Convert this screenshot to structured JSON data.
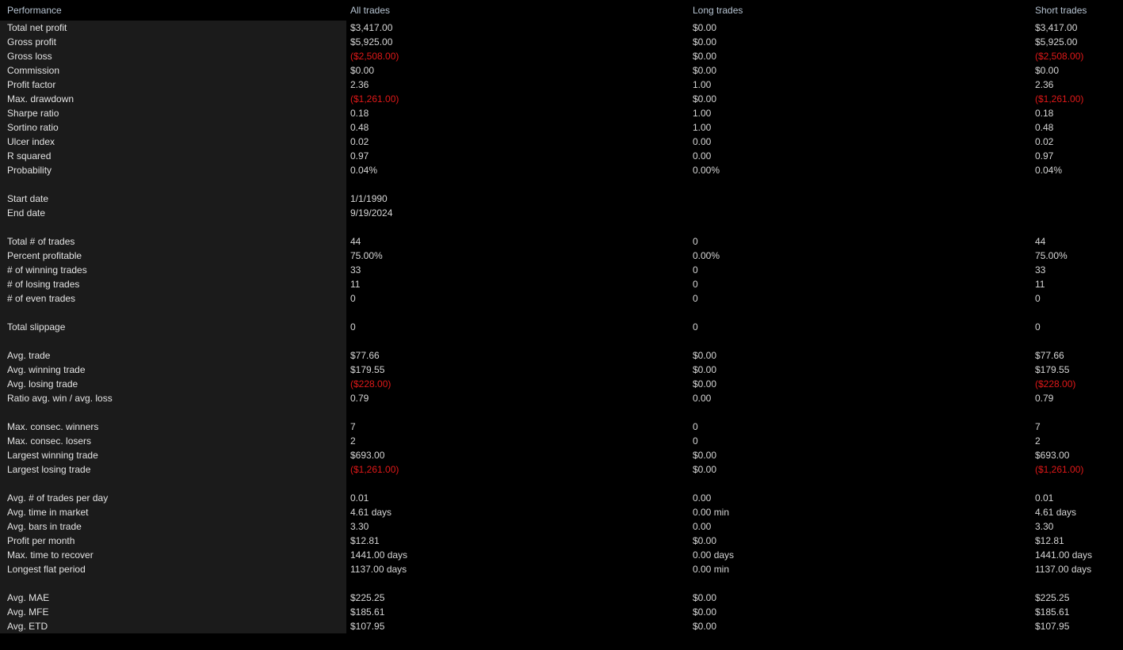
{
  "header": {
    "label_column": "Performance",
    "columns": [
      "All trades",
      "Long trades",
      "Short trades"
    ]
  },
  "colors": {
    "background": "#000000",
    "label_panel": "#1b1b1b",
    "header_text": "#b6c3d1",
    "value_text": "#d6d6d6",
    "negative_text": "#e01818"
  },
  "sections": [
    {
      "rows": [
        {
          "label": "Total net profit",
          "all": "$3,417.00",
          "long": "$0.00",
          "short": "$3,417.00",
          "all_neg": false,
          "long_neg": false,
          "short_neg": false
        },
        {
          "label": "Gross profit",
          "all": "$5,925.00",
          "long": "$0.00",
          "short": "$5,925.00",
          "all_neg": false,
          "long_neg": false,
          "short_neg": false
        },
        {
          "label": "Gross loss",
          "all": "($2,508.00)",
          "long": "$0.00",
          "short": "($2,508.00)",
          "all_neg": true,
          "long_neg": false,
          "short_neg": true
        },
        {
          "label": "Commission",
          "all": "$0.00",
          "long": "$0.00",
          "short": "$0.00",
          "all_neg": false,
          "long_neg": false,
          "short_neg": false
        },
        {
          "label": "Profit factor",
          "all": "2.36",
          "long": "1.00",
          "short": "2.36",
          "all_neg": false,
          "long_neg": false,
          "short_neg": false
        },
        {
          "label": "Max. drawdown",
          "all": "($1,261.00)",
          "long": "$0.00",
          "short": "($1,261.00)",
          "all_neg": true,
          "long_neg": false,
          "short_neg": true
        },
        {
          "label": "Sharpe ratio",
          "all": "0.18",
          "long": "1.00",
          "short": "0.18",
          "all_neg": false,
          "long_neg": false,
          "short_neg": false
        },
        {
          "label": "Sortino ratio",
          "all": "0.48",
          "long": "1.00",
          "short": "0.48",
          "all_neg": false,
          "long_neg": false,
          "short_neg": false
        },
        {
          "label": "Ulcer index",
          "all": "0.02",
          "long": "0.00",
          "short": "0.02",
          "all_neg": false,
          "long_neg": false,
          "short_neg": false
        },
        {
          "label": "R squared",
          "all": "0.97",
          "long": "0.00",
          "short": "0.97",
          "all_neg": false,
          "long_neg": false,
          "short_neg": false
        },
        {
          "label": "Probability",
          "all": "0.04%",
          "long": "0.00%",
          "short": "0.04%",
          "all_neg": false,
          "long_neg": false,
          "short_neg": false
        }
      ]
    },
    {
      "rows": [
        {
          "label": "Start date",
          "all": "1/1/1990",
          "long": "",
          "short": "",
          "all_neg": false,
          "long_neg": false,
          "short_neg": false
        },
        {
          "label": "End date",
          "all": "9/19/2024",
          "long": "",
          "short": "",
          "all_neg": false,
          "long_neg": false,
          "short_neg": false
        }
      ]
    },
    {
      "rows": [
        {
          "label": "Total # of trades",
          "all": "44",
          "long": "0",
          "short": "44",
          "all_neg": false,
          "long_neg": false,
          "short_neg": false
        },
        {
          "label": "Percent profitable",
          "all": "75.00%",
          "long": "0.00%",
          "short": "75.00%",
          "all_neg": false,
          "long_neg": false,
          "short_neg": false
        },
        {
          "label": "# of winning trades",
          "all": "33",
          "long": "0",
          "short": "33",
          "all_neg": false,
          "long_neg": false,
          "short_neg": false
        },
        {
          "label": "# of losing trades",
          "all": "11",
          "long": "0",
          "short": "11",
          "all_neg": false,
          "long_neg": false,
          "short_neg": false
        },
        {
          "label": "# of even trades",
          "all": "0",
          "long": "0",
          "short": "0",
          "all_neg": false,
          "long_neg": false,
          "short_neg": false
        }
      ]
    },
    {
      "rows": [
        {
          "label": "Total slippage",
          "all": "0",
          "long": "0",
          "short": "0",
          "all_neg": false,
          "long_neg": false,
          "short_neg": false
        }
      ]
    },
    {
      "rows": [
        {
          "label": "Avg. trade",
          "all": "$77.66",
          "long": "$0.00",
          "short": "$77.66",
          "all_neg": false,
          "long_neg": false,
          "short_neg": false
        },
        {
          "label": "Avg. winning trade",
          "all": "$179.55",
          "long": "$0.00",
          "short": "$179.55",
          "all_neg": false,
          "long_neg": false,
          "short_neg": false
        },
        {
          "label": "Avg. losing trade",
          "all": "($228.00)",
          "long": "$0.00",
          "short": "($228.00)",
          "all_neg": true,
          "long_neg": false,
          "short_neg": true
        },
        {
          "label": "Ratio avg. win / avg. loss",
          "all": "0.79",
          "long": "0.00",
          "short": "0.79",
          "all_neg": false,
          "long_neg": false,
          "short_neg": false
        }
      ]
    },
    {
      "rows": [
        {
          "label": "Max. consec. winners",
          "all": "7",
          "long": "0",
          "short": "7",
          "all_neg": false,
          "long_neg": false,
          "short_neg": false
        },
        {
          "label": "Max. consec. losers",
          "all": "2",
          "long": "0",
          "short": "2",
          "all_neg": false,
          "long_neg": false,
          "short_neg": false
        },
        {
          "label": "Largest winning trade",
          "all": "$693.00",
          "long": "$0.00",
          "short": "$693.00",
          "all_neg": false,
          "long_neg": false,
          "short_neg": false
        },
        {
          "label": "Largest losing trade",
          "all": "($1,261.00)",
          "long": "$0.00",
          "short": "($1,261.00)",
          "all_neg": true,
          "long_neg": false,
          "short_neg": true
        }
      ]
    },
    {
      "rows": [
        {
          "label": "Avg. # of trades per day",
          "all": "0.01",
          "long": "0.00",
          "short": "0.01",
          "all_neg": false,
          "long_neg": false,
          "short_neg": false
        },
        {
          "label": "Avg. time in market",
          "all": "4.61 days",
          "long": "0.00 min",
          "short": "4.61 days",
          "all_neg": false,
          "long_neg": false,
          "short_neg": false
        },
        {
          "label": "Avg. bars in trade",
          "all": "3.30",
          "long": "0.00",
          "short": "3.30",
          "all_neg": false,
          "long_neg": false,
          "short_neg": false
        },
        {
          "label": "Profit per month",
          "all": "$12.81",
          "long": "$0.00",
          "short": "$12.81",
          "all_neg": false,
          "long_neg": false,
          "short_neg": false
        },
        {
          "label": "Max. time to recover",
          "all": "1441.00 days",
          "long": "0.00 days",
          "short": "1441.00 days",
          "all_neg": false,
          "long_neg": false,
          "short_neg": false
        },
        {
          "label": "Longest flat period",
          "all": "1137.00 days",
          "long": "0.00 min",
          "short": "1137.00 days",
          "all_neg": false,
          "long_neg": false,
          "short_neg": false
        }
      ]
    },
    {
      "rows": [
        {
          "label": "Avg. MAE",
          "all": "$225.25",
          "long": "$0.00",
          "short": "$225.25",
          "all_neg": false,
          "long_neg": false,
          "short_neg": false
        },
        {
          "label": "Avg. MFE",
          "all": "$185.61",
          "long": "$0.00",
          "short": "$185.61",
          "all_neg": false,
          "long_neg": false,
          "short_neg": false
        },
        {
          "label": "Avg. ETD",
          "all": "$107.95",
          "long": "$0.00",
          "short": "$107.95",
          "all_neg": false,
          "long_neg": false,
          "short_neg": false
        }
      ]
    }
  ]
}
